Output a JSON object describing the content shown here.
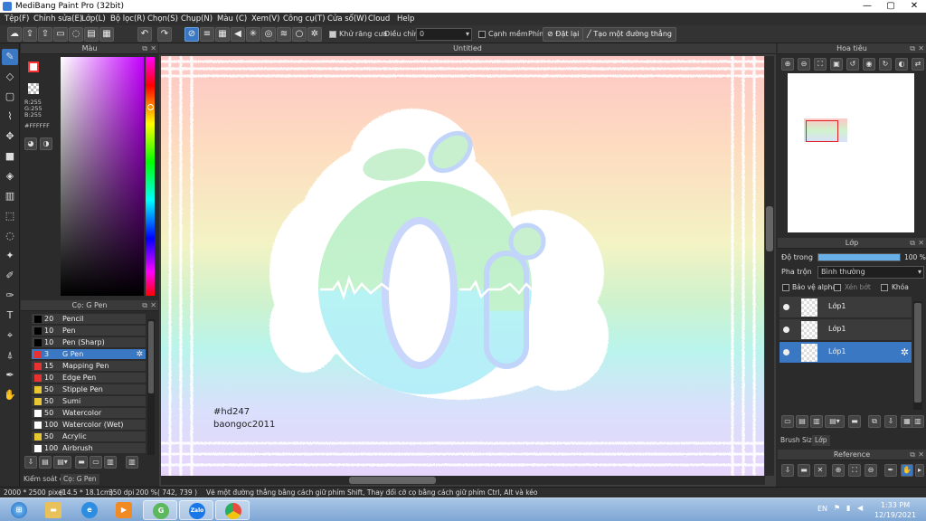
{
  "window": {
    "title": "MediBang Paint Pro (32bit)",
    "minimize": "—",
    "maximize": "▢",
    "close": "✕"
  },
  "menu": [
    "Tệp(F)",
    "Chỉnh sửa(E)",
    "Lớp(L)",
    "Bộ lọc(R)",
    "Chọn(S)",
    "Chụp(N)",
    "Màu (C)",
    "Xem(V)",
    "Công cụ(T)",
    "Cửa sổ(W)",
    "Cloud",
    "Help"
  ],
  "toolbar": {
    "antialias_label": "Khử răng cưa",
    "adjust_label": "Điều chỉnh",
    "adjust_value": "0",
    "edge_label": "Cạnh mềm",
    "key_label": "Phím",
    "reset_label": "Đặt lại",
    "line_label": "Tạo một đường thẳng"
  },
  "color_panel": {
    "title": "Màu",
    "r": "R:255",
    "g": "G:255",
    "b": "B:255",
    "hex": "#FFFFFF",
    "primary_color": "#ff3333",
    "secondary_color": "#ffffff",
    "hue": "#c400ff"
  },
  "brush_panel": {
    "title": "Cọ: G Pen",
    "brushes": [
      {
        "size": "20",
        "name": "Pencil",
        "color": "#000000"
      },
      {
        "size": "10",
        "name": "Pen",
        "color": "#000000"
      },
      {
        "size": "10",
        "name": "Pen (Sharp)",
        "color": "#000000"
      },
      {
        "size": "3",
        "name": "G Pen",
        "color": "#e83232",
        "selected": true
      },
      {
        "size": "15",
        "name": "Mapping Pen",
        "color": "#e83232"
      },
      {
        "size": "10",
        "name": "Edge Pen",
        "color": "#e83232"
      },
      {
        "size": "50",
        "name": "Stipple Pen",
        "color": "#e8c832"
      },
      {
        "size": "50",
        "name": "Sumi",
        "color": "#e8c832"
      },
      {
        "size": "50",
        "name": "Watercolor",
        "color": "#ffffff"
      },
      {
        "size": "100",
        "name": "Watercolor (Wet)",
        "color": "#ffffff"
      },
      {
        "size": "50",
        "name": "Acrylic",
        "color": "#e8c832"
      },
      {
        "size": "100",
        "name": "Airbrush",
        "color": "#ffffff"
      }
    ],
    "tab_control": "Kiểm soát cọ",
    "tab_brush": "Cọ: G Pen"
  },
  "canvas": {
    "title": "Untitled",
    "letters": "Ơi",
    "tag_line1": "#hd247",
    "tag_line2": "baongoc2011"
  },
  "navigator": {
    "title": "Hoa tiêu"
  },
  "layer_panel": {
    "title": "Lớp",
    "opacity_label": "Độ trong",
    "opacity_value": "100 %",
    "opacity_fraction": 1.0,
    "blend_label": "Pha trộn",
    "blend_value": "Bình thường",
    "protect_alpha": "Bảo vệ alpha",
    "clip": "Xén bớt",
    "lock": "Khóa",
    "layers": [
      {
        "name": "Lớp1"
      },
      {
        "name": "Lớp1"
      },
      {
        "name": "Lớp1",
        "selected": true
      }
    ],
    "tab_brush_size": "Brush Size",
    "tab_layer": "Lớp"
  },
  "reference_panel": {
    "title": "Reference"
  },
  "status": {
    "size": "2000 * 2500 pixel",
    "size_cm": "(14.5 * 18.1cm)",
    "dpi": "350 dpi",
    "zoom": "200 %",
    "cursor": "( 742, 739 )",
    "hint": "Vẽ một đường thẳng bằng cách giữ phím Shift, Thay đổi cỡ cọ bằng cách giữ phím Ctrl, Alt và kéo"
  },
  "taskbar": {
    "language": "EN",
    "time": "1:33 PM",
    "date": "12/19/2021",
    "zalo_label": "Zalo"
  }
}
